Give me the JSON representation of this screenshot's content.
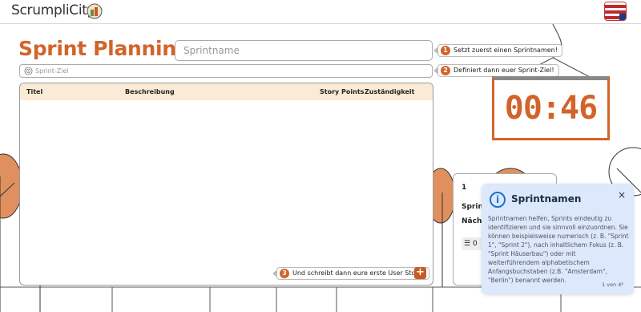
{
  "header": {
    "logo_text": "ScrumpliCity",
    "language_flag_icon": "uk-flag-icon"
  },
  "main": {
    "title": "Sprint Planning -",
    "sprint_name_placeholder": "Sprintname",
    "sprint_goal_placeholder": "Sprint-Ziel"
  },
  "hints": [
    {
      "num": "1",
      "text": "Setzt zuerst einen Sprintnamen!"
    },
    {
      "num": "2",
      "text": "Definiert dann euer Sprint-Ziel!"
    },
    {
      "num": "3",
      "text": "Und schreibt dann eure erste User Story!"
    }
  ],
  "table": {
    "columns": [
      "Titel",
      "Beschreibung",
      "Story Points",
      "Zuständigkeit"
    ],
    "add_button": "+"
  },
  "timer": {
    "value": "00:46"
  },
  "side_card": {
    "line1": "1",
    "line2": "Sprint",
    "line3": "Nächs",
    "chip": "0"
  },
  "popover": {
    "title": "Sprintnamen",
    "close": "×",
    "body": "Sprintnamen helfen, Sprints eindeutig zu identifizieren und sie sinnvoll einzuordnen. Sie können beispielsweise numerisch (z. B. \"Sprint 1\", \"Sprint 2\"), nach inhaltlichem Fokus (z. B. \"Sprint Häuserbau\") oder mit weiterführendem alphabetischem Anfangsbuchstaben (z.B. \"Amsterdam\", \"Berlin\") benannt werden.",
    "counter": "1 von 4",
    "next": "›"
  },
  "colors": {
    "accent": "#d2642a",
    "table_header": "#fbebd6",
    "popover_bg": "#dce8fb",
    "info_blue": "#1f6fcf"
  }
}
